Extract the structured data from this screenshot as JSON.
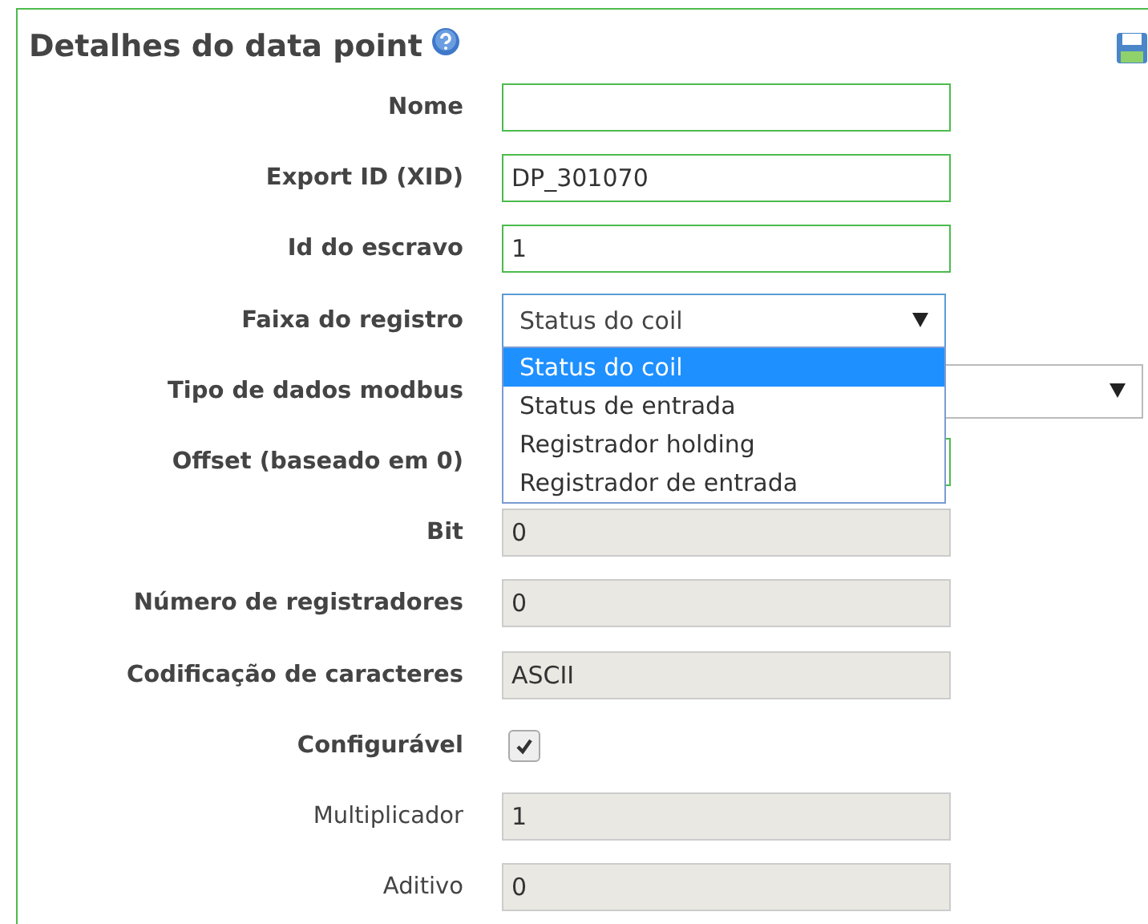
{
  "title": "Detalhes do data point",
  "rows": [
    {
      "label": "Nome",
      "bold": true,
      "kind": "text",
      "value": "",
      "disabled": false
    },
    {
      "label": "Export ID (XID)",
      "bold": true,
      "kind": "text",
      "value": "DP_301070",
      "disabled": false
    },
    {
      "label": "Id do escravo",
      "bold": true,
      "kind": "text",
      "value": "1",
      "disabled": false
    },
    {
      "label": "Faixa do registro",
      "bold": true,
      "kind": "select",
      "value": "Status do coil",
      "wide": false,
      "open": true,
      "options": [
        {
          "label": "Status do coil",
          "selected": true
        },
        {
          "label": "Status de entrada",
          "selected": false
        },
        {
          "label": "Registrador holding",
          "selected": false
        },
        {
          "label": "Registrador de entrada",
          "selected": false
        }
      ]
    },
    {
      "label": "Tipo de dados modbus",
      "bold": true,
      "kind": "select",
      "value": "",
      "wide": true,
      "open": false
    },
    {
      "label": "Offset (baseado em 0)",
      "bold": true,
      "kind": "text",
      "value": "",
      "disabled": false
    },
    {
      "label": "Bit",
      "bold": true,
      "kind": "text",
      "value": "0",
      "disabled": true
    },
    {
      "label": "Número de registradores",
      "bold": true,
      "kind": "text",
      "value": "0",
      "disabled": true
    },
    {
      "label": "Codificação de caracteres",
      "bold": true,
      "kind": "text",
      "value": "ASCII",
      "disabled": true
    },
    {
      "label": "Configurável",
      "bold": true,
      "kind": "checkbox",
      "checked": true
    },
    {
      "label": "Multiplicador",
      "bold": false,
      "kind": "text",
      "value": "1",
      "disabled": true
    },
    {
      "label": "Aditivo",
      "bold": false,
      "kind": "text",
      "value": "0",
      "disabled": true
    }
  ]
}
